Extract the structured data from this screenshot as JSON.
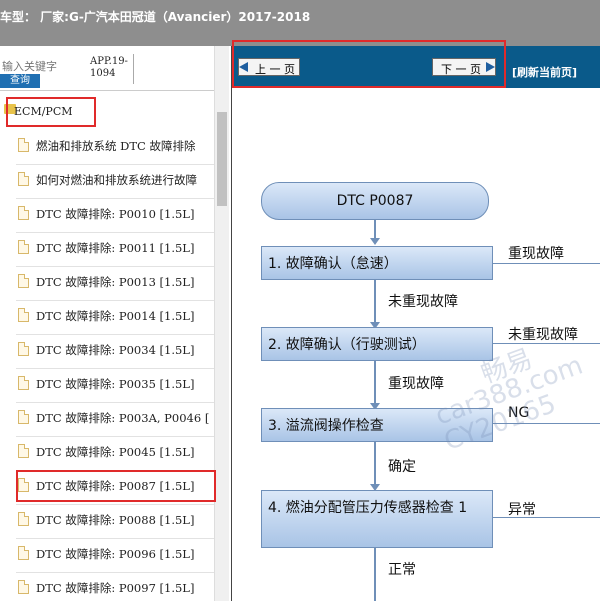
{
  "topbar": {
    "title": "车型： 厂家:G-广汽本田冠道（Avancier）2017-2018"
  },
  "left": {
    "search": {
      "placeholder": "输入关键字",
      "button": "查询"
    },
    "app_code": {
      "line1": "APP.19-",
      "line2": "1094"
    },
    "folder": "ECM/PCM",
    "items": [
      "燃油和排放系统 DTC 故障排除",
      "如何对燃油和排放系统进行故障",
      "DTC 故障排除: P0010 [1.5L]",
      "DTC 故障排除: P0011 [1.5L]",
      "DTC 故障排除: P0013 [1.5L]",
      "DTC 故障排除: P0014 [1.5L]",
      "DTC 故障排除: P0034 [1.5L]",
      "DTC 故障排除: P0035 [1.5L]",
      "DTC 故障排除: P003A, P0046 [",
      "DTC 故障排除: P0045 [1.5L]",
      "DTC 故障排除: P0087 [1.5L]",
      "DTC 故障排除: P0088 [1.5L]",
      "DTC 故障排除: P0096 [1.5L]",
      "DTC 故障排除: P0097 [1.5L]"
    ]
  },
  "nav": {
    "prev": "上 一 页",
    "next": "下 一 页",
    "refresh": "[刷新当前页]"
  },
  "flow": {
    "start": "DTC P0087",
    "steps": [
      "1.  故障确认（怠速）",
      "2.  故障确认（行驶测试）",
      "3.  溢流阀操作检查",
      "4.  燃油分配管压力传感器检查 1"
    ],
    "between": [
      "未重现故障",
      "重现故障",
      "确定",
      "正常"
    ],
    "side": [
      "重现故障",
      "未重现故障",
      "NG",
      "异常"
    ]
  },
  "watermark": {
    "a": "畅易",
    "b": "car388.com",
    "c": "CY20165"
  }
}
